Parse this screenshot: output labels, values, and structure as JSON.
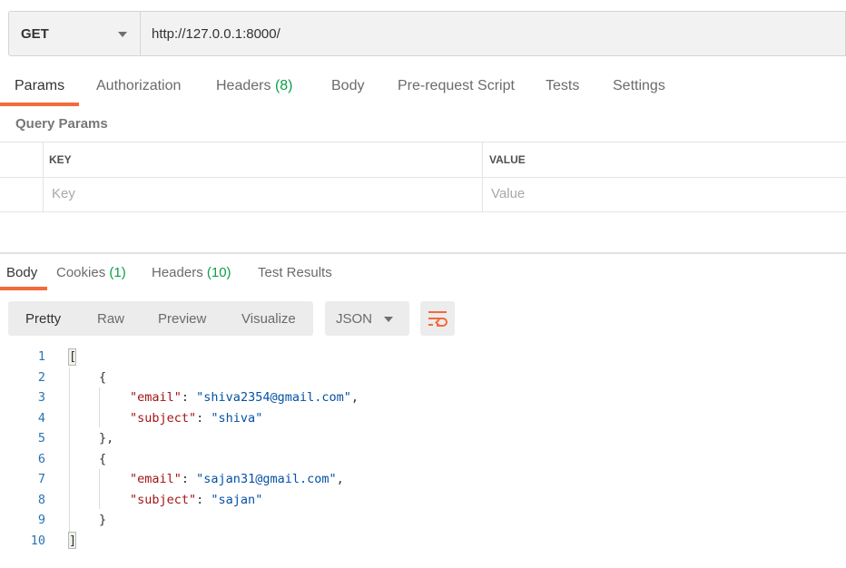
{
  "request": {
    "method": "GET",
    "url": "http://127.0.0.1:8000/"
  },
  "request_tabs": [
    {
      "label": "Params",
      "count": ""
    },
    {
      "label": "Authorization",
      "count": ""
    },
    {
      "label": "Headers",
      "count": "(8)"
    },
    {
      "label": "Body",
      "count": ""
    },
    {
      "label": "Pre-request Script",
      "count": ""
    },
    {
      "label": "Tests",
      "count": ""
    },
    {
      "label": "Settings",
      "count": ""
    }
  ],
  "query_params": {
    "title": "Query Params",
    "key_header": "KEY",
    "value_header": "VALUE",
    "key_placeholder": "Key",
    "value_placeholder": "Value"
  },
  "response_tabs": [
    {
      "label": "Body",
      "count": ""
    },
    {
      "label": "Cookies",
      "count": "(1)"
    },
    {
      "label": "Headers",
      "count": "(10)"
    },
    {
      "label": "Test Results",
      "count": ""
    }
  ],
  "view_modes": [
    "Pretty",
    "Raw",
    "Preview",
    "Visualize"
  ],
  "format": "JSON",
  "colors": {
    "accent": "#f26b3a",
    "count": "#0d9e4a"
  },
  "icons": {
    "wrap": "wrap-lines-icon",
    "method_caret": "chevron-down-icon",
    "format_caret": "chevron-down-icon"
  },
  "code_lines": [
    {
      "n": "1",
      "parts": [
        {
          "t": "p",
          "v": "["
        }
      ]
    },
    {
      "n": "2",
      "parts": [
        {
          "t": "p",
          "v": "{"
        }
      ]
    },
    {
      "n": "3",
      "parts": [
        {
          "t": "k",
          "v": "\"email\""
        },
        {
          "t": "p",
          "v": ": "
        },
        {
          "t": "s",
          "v": "\"shiva2354@gmail.com\""
        },
        {
          "t": "p",
          "v": ","
        }
      ]
    },
    {
      "n": "4",
      "parts": [
        {
          "t": "k",
          "v": "\"subject\""
        },
        {
          "t": "p",
          "v": ": "
        },
        {
          "t": "s",
          "v": "\"shiva\""
        }
      ]
    },
    {
      "n": "5",
      "parts": [
        {
          "t": "p",
          "v": "},"
        }
      ]
    },
    {
      "n": "6",
      "parts": [
        {
          "t": "p",
          "v": "{"
        }
      ]
    },
    {
      "n": "7",
      "parts": [
        {
          "t": "k",
          "v": "\"email\""
        },
        {
          "t": "p",
          "v": ": "
        },
        {
          "t": "s",
          "v": "\"sajan31@gmail.com\""
        },
        {
          "t": "p",
          "v": ","
        }
      ]
    },
    {
      "n": "8",
      "parts": [
        {
          "t": "k",
          "v": "\"subject\""
        },
        {
          "t": "p",
          "v": ": "
        },
        {
          "t": "s",
          "v": "\"sajan\""
        }
      ]
    },
    {
      "n": "9",
      "parts": [
        {
          "t": "p",
          "v": "}"
        }
      ]
    },
    {
      "n": "10",
      "parts": [
        {
          "t": "p",
          "v": "]"
        }
      ]
    }
  ]
}
